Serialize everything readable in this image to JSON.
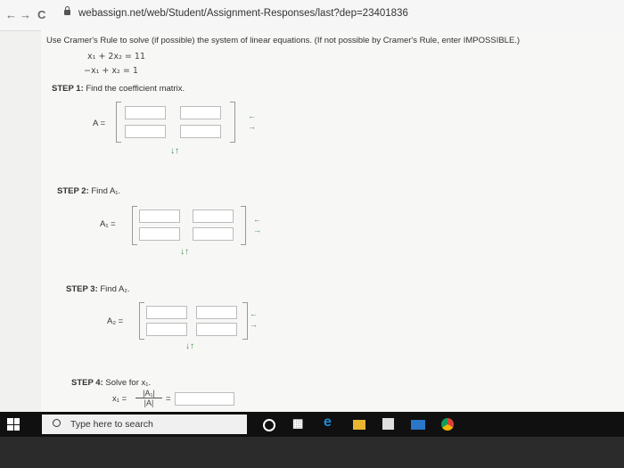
{
  "browser": {
    "back": "←",
    "forward": "→",
    "reload": "C",
    "url": "webassign.net/web/Student/Assignment-Responses/last?dep=23401836"
  },
  "question": {
    "prompt": "Use Cramer's Rule to solve (if possible) the system of linear equations. (If not possible by Cramer's Rule, enter IMPOSSIBLE.)",
    "eq1": "x₁ + 2x₂ = 11",
    "eq2": "−x₁ + x₂ = 1"
  },
  "steps": {
    "s1_label": "STEP 1:",
    "s1_text": "Find the coefficient matrix.",
    "s1_var": "A =",
    "s2_label": "STEP 2:",
    "s2_text": "Find A₁.",
    "s2_var": "A₁ =",
    "s3_label": "STEP 3:",
    "s3_text": "Find A₂.",
    "s3_var": "A₂ =",
    "s4_label": "STEP 4:",
    "s4_text": "Solve for x₁.",
    "s4_var": "x₁ =",
    "s4_num": "|A₁|",
    "s4_den": "|A|",
    "s4_eq": "="
  },
  "controls": {
    "col_arrows": "↓↑",
    "row_remove": "←",
    "row_add": "→"
  },
  "taskbar": {
    "search_placeholder": "Type here to search",
    "icons": [
      "windows-icon",
      "search-icon",
      "cortana-icon",
      "task-view-icon",
      "edge-icon",
      "file-explorer-icon",
      "store-icon",
      "mail-icon",
      "chrome-icon"
    ]
  }
}
